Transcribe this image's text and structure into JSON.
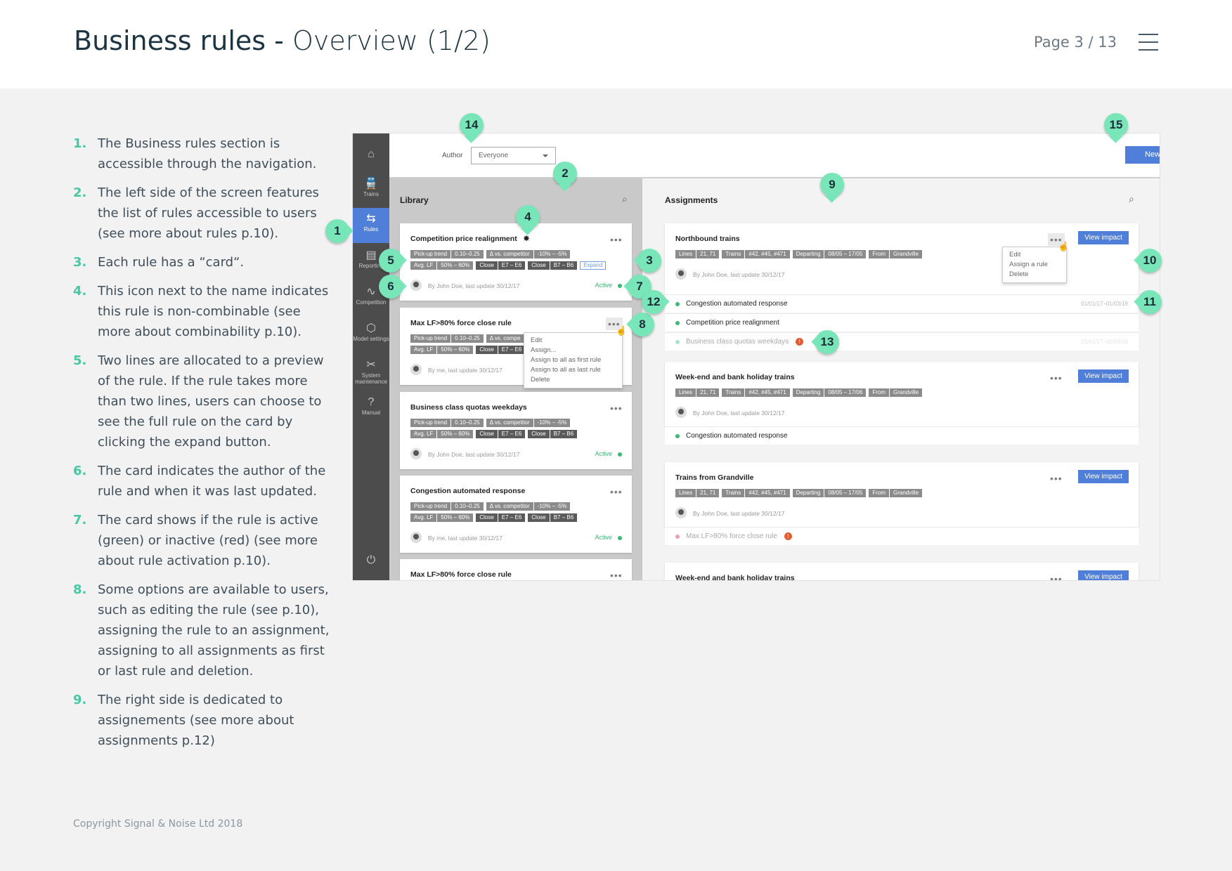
{
  "header": {
    "title_main": "Business rules -",
    "title_sub": "Overview (1/2)",
    "page": "Page 3 / 13"
  },
  "notes": [
    {
      "num": "1.",
      "text": "The Business rules section is accessible through the navigation."
    },
    {
      "num": "2.",
      "text": "The left side of the screen features the list of rules accessible to users (see more about rules p.10)."
    },
    {
      "num": "3.",
      "text": "Each rule has a “card“."
    },
    {
      "num": "4.",
      "text": "This icon next to the name indicates this rule is non-combinable (see more about combinability p.10)."
    },
    {
      "num": "5.",
      "text": "Two lines are allocated to a preview of the rule. If the rule takes more than two lines, users can choose to see the full rule on the card by clicking the expand button."
    },
    {
      "num": "6.",
      "text": "The card indicates the author of the rule and when it was last updated."
    },
    {
      "num": "7.",
      "text": "The card shows if the rule is active (green) or inactive (red) (see more about rule activation p.10)."
    },
    {
      "num": "8.",
      "text": "Some options are available to users, such as editing the rule (see p.10), assigning the rule to an assignment, assigning to all assignments as first or last rule and deletion."
    },
    {
      "num": "9.",
      "text": "The right side is dedicated to assignements (see more about assignments p.12)"
    }
  ],
  "copyright": "Copyright Signal & Noise Ltd 2018",
  "app": {
    "nav": [
      {
        "icon": "⌂",
        "label": ""
      },
      {
        "icon": "🚆",
        "label": "Trains"
      },
      {
        "icon": "⇆",
        "label": "Rules"
      },
      {
        "icon": "▤",
        "label": "Reporting"
      },
      {
        "icon": "∿",
        "label": "Competition"
      },
      {
        "icon": "⬡",
        "label": "Model settings"
      },
      {
        "icon": "✂",
        "label": "System maintenance"
      },
      {
        "icon": "?",
        "label": "Manual"
      },
      {
        "icon": "⏻",
        "label": ""
      }
    ],
    "author_label": "Author",
    "author_value": "Everyone",
    "new_label": "New",
    "library_title": "Library",
    "assignments_title": "Assignments",
    "dots": "•••",
    "library_cards": [
      {
        "title": "Competition price realignment",
        "non_combinable": "✸",
        "tags1": [
          [
            "Pick-up trend",
            "0.10–0.25"
          ],
          [
            "Δ vs. competitor",
            "-10% – -5%"
          ]
        ],
        "tags2": [
          [
            "Avg. LF",
            "50% – 60%"
          ],
          [
            "Close",
            "E7 – E6"
          ],
          [
            "Close",
            "B7 – B6"
          ]
        ],
        "expand": "Expand",
        "meta": "By John Doe, last update 30/12/17",
        "status": "Active"
      },
      {
        "title": "Max LF>80% force close rule",
        "tags1": [
          [
            "Pick-up trend",
            "0.10–0.25"
          ],
          [
            "Δ vs. compe",
            ""
          ]
        ],
        "tags2": [
          [
            "Avg. LF",
            "50% – 60%"
          ],
          [
            "Close",
            "E7 – E6"
          ]
        ],
        "meta": "By me, last update 30/12/17",
        "menu": [
          "Edit",
          "Assign...",
          "Assign to all as first rule",
          "Assign to all as last rule",
          "Delete"
        ]
      },
      {
        "title": "Business class quotas weekdays",
        "tags1": [
          [
            "Pick-up trend",
            "0.10–0.25"
          ],
          [
            "Δ vs. competitor",
            "-10% – -5%"
          ]
        ],
        "tags2": [
          [
            "Avg. LF",
            "50% – 60%"
          ],
          [
            "Close",
            "E7 – E6"
          ],
          [
            "Close",
            "B7 – B6"
          ]
        ],
        "meta": "By John Doe, last update 30/12/17",
        "status": "Active"
      },
      {
        "title": "Congestion automated response",
        "tags1": [
          [
            "Pick-up trend",
            "0.10–0.25"
          ],
          [
            "Δ vs. competitor",
            "-10% – -5%"
          ]
        ],
        "tags2": [
          [
            "Avg. LF",
            "50% – 60%"
          ],
          [
            "Close",
            "E7 – E6"
          ],
          [
            "Close",
            "B7 – B6"
          ]
        ],
        "meta": "By me, last update 30/12/17",
        "status": "Active"
      },
      {
        "title": "Max LF>80% force close rule"
      }
    ],
    "assignment_cards": [
      {
        "title": "Northbound trains",
        "tags": [
          [
            "Lines",
            "21, 71"
          ],
          [
            "Trains",
            "#42, #45, #471"
          ],
          [
            "Departing",
            "08/05 – 17/05"
          ],
          [
            "From",
            "Grandville"
          ]
        ],
        "meta": "By John Doe, last update 30/12/17",
        "view": "View impact",
        "menu": [
          "Edit",
          "Assign a rule",
          "Delete"
        ],
        "rules": [
          {
            "name": "Congestion automated response",
            "dates": "01/01/17–01/03/18"
          },
          {
            "name": "Competition price realignment"
          },
          {
            "name": "Business class quotas weekdays",
            "warn": "!",
            "dates": "01/01/17–01/03/18"
          }
        ]
      },
      {
        "title": "Week-end and bank holiday trains",
        "tags": [
          [
            "Lines",
            "21, 71"
          ],
          [
            "Trains",
            "#42, #45, #471"
          ],
          [
            "Departing",
            "08/05 – 17/06"
          ],
          [
            "From",
            "Grandville"
          ]
        ],
        "meta": "By John Doe, last update 30/12/17",
        "view": "View impact",
        "rules": [
          {
            "name": "Congestion automated response"
          }
        ]
      },
      {
        "title": "Trains from Grandville",
        "tags": [
          [
            "Lines",
            "21, 71"
          ],
          [
            "Trains",
            "#42, #45, #471"
          ],
          [
            "Departing",
            "08/05 – 17/05"
          ],
          [
            "From",
            "Grandville"
          ]
        ],
        "meta": "By John Doe, last update 30/12/17",
        "view": "View impact",
        "rules": [
          {
            "name": "Max LF>80% force close rule",
            "warn": "!"
          }
        ]
      },
      {
        "title": "Week-end and bank holiday trains",
        "view": "View impact"
      }
    ]
  },
  "callouts": [
    "1",
    "2",
    "3",
    "4",
    "5",
    "6",
    "7",
    "8",
    "9",
    "10",
    "11",
    "12",
    "13",
    "14",
    "15"
  ],
  "colors": {
    "accent": "#78e6b9",
    "primary": "#4f7fd8",
    "active": "#3cba74",
    "warning": "#e25d33"
  }
}
